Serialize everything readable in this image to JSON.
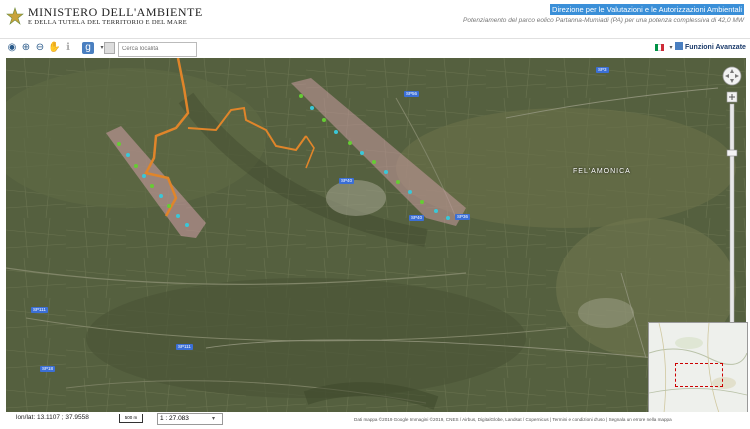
{
  "header": {
    "title": "MINISTERO DELL'AMBIENTE",
    "subtitle": "E DELLA TUTELA DEL TERRITORIO E DEL MARE",
    "link": "Direzione per le Valutazioni e le Autorizzazioni Ambientali",
    "project": "Potenziamento del parco eolico Partanna-Mumiadi (PA) per una potenza complessiva di 42,0 MW"
  },
  "toolbar": {
    "search_placeholder": "Cerca località",
    "advanced_label": "Funzioni Avanzate",
    "language_flag_colors": [
      "#009246",
      "#ffffff",
      "#ce2b37"
    ]
  },
  "map": {
    "place_label": "FEL'AMONICA",
    "road_badges": [
      "SP3",
      "SP56",
      "SP40",
      "SP40",
      "SP36",
      "SP111",
      "SP111",
      "SP18"
    ],
    "colors": {
      "imagery_base": "#4f5a3e",
      "zone_fill": "#c89aa0",
      "turbine_green": "#66cc33",
      "turbine_cyan": "#3ac7d8",
      "track": "#e0852a"
    }
  },
  "footer": {
    "coords": "lon/lat: 13.1107 ; 37.9558",
    "scale_label": "500 m",
    "scale_value": "1 : 27.083",
    "copyright": "Dati mappa ©2019 Google Immagini ©2019, CNES / Airbus, DigitalGlobe, Landsat / Copernicus | Termini e condizioni d'uso | Segnala un errore nella mappa"
  }
}
